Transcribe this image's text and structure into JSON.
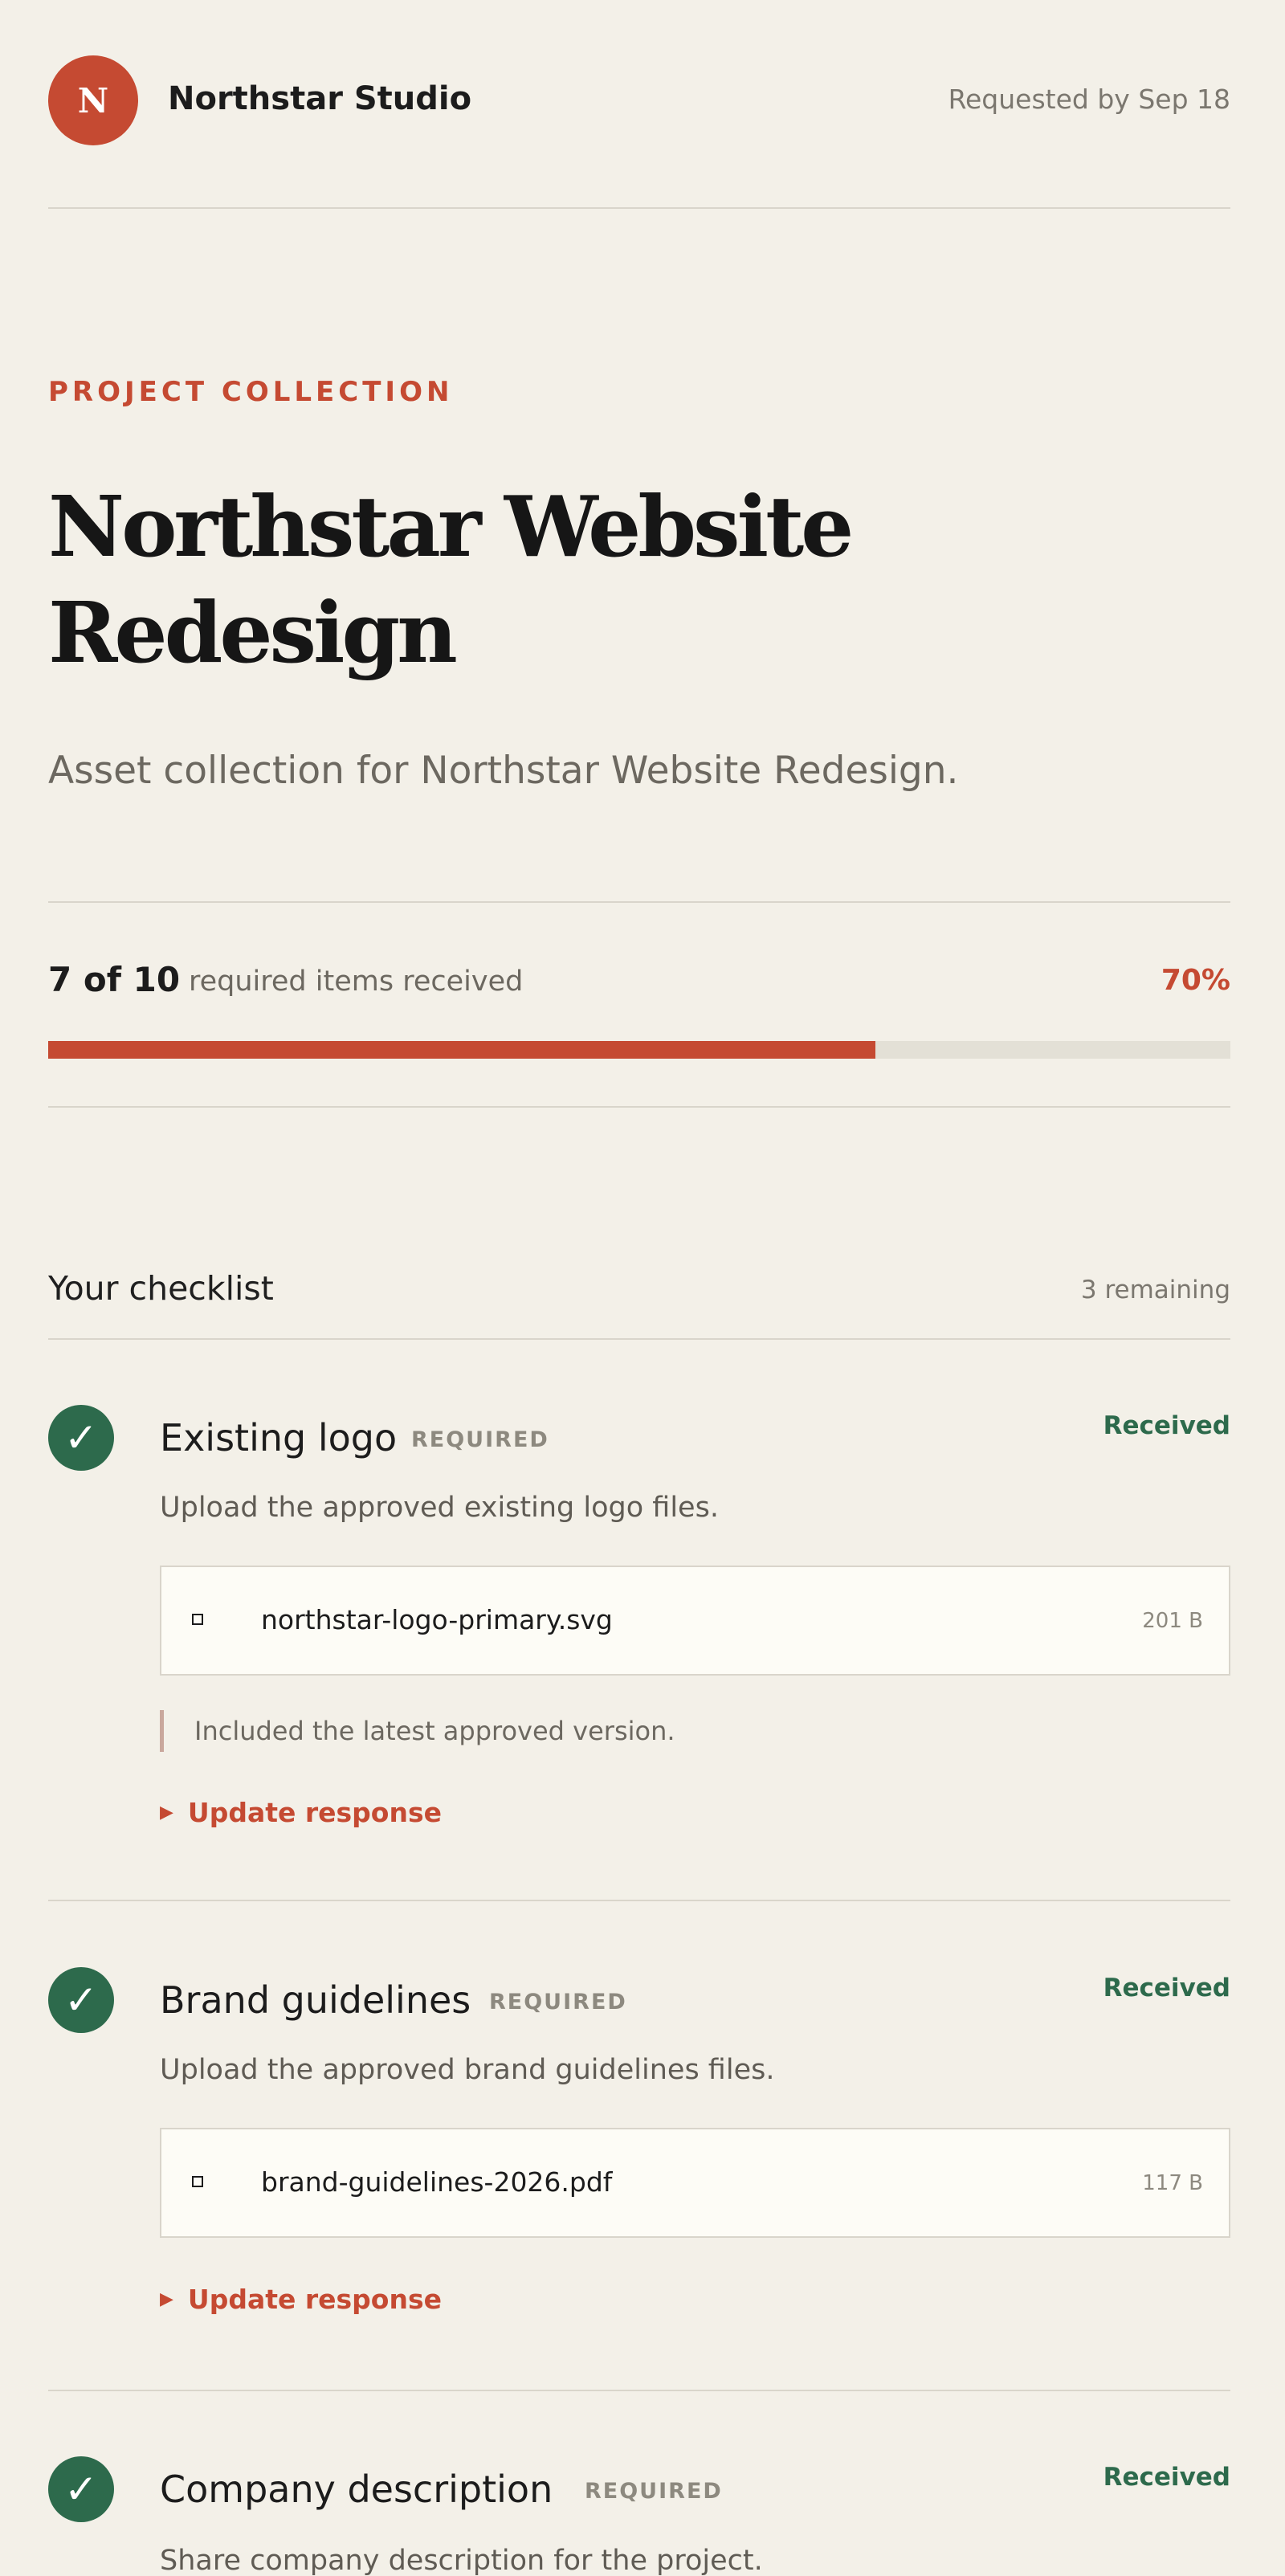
{
  "header": {
    "logo_letter": "N",
    "studio": "Northstar Studio",
    "requested": "Requested by Sep 18"
  },
  "hero": {
    "eyebrow": "PROJECT COLLECTION",
    "title": "Northstar Website Redesign",
    "subtitle": "Asset collection for Northstar Website Redesign."
  },
  "progress": {
    "count": "7 of 10",
    "label": "required items received",
    "percent_text": "70%",
    "fraction": 0.7
  },
  "checklist": {
    "title": "Your checklist",
    "remaining": "3 remaining",
    "items": [
      {
        "name": "Existing logo",
        "badge": "REQUIRED",
        "status": "Received",
        "check": "✓",
        "description": "Upload the approved existing logo files.",
        "file_name": "northstar-logo-primary.svg",
        "file_size": "201 B",
        "note": "Included the latest approved version.",
        "update": "Update response",
        "update_icon": "▶"
      },
      {
        "name": "Brand guidelines",
        "badge": "REQUIRED",
        "status": "Received",
        "check": "✓",
        "description": "Upload the approved brand guidelines files.",
        "file_name": "brand-guidelines-2026.pdf",
        "file_size": "117 B",
        "update": "Update response",
        "update_icon": "▶"
      },
      {
        "name": "Company description",
        "badge": "REQUIRED",
        "status": "Received",
        "check": "✓",
        "description": "Share company description for the project."
      }
    ]
  }
}
